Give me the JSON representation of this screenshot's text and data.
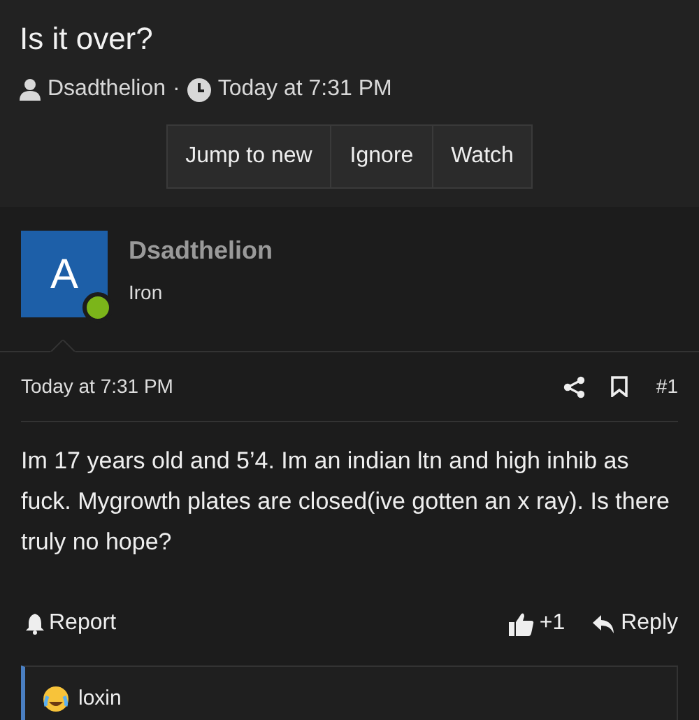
{
  "thread": {
    "title": "Is it over?",
    "author": "Dsadthelion",
    "separator": "·",
    "time": "Today at 7:31 PM"
  },
  "thread_buttons": [
    "Jump to new",
    "Ignore",
    "Watch"
  ],
  "post": {
    "avatar_letter": "A",
    "online": true,
    "username": "Dsadthelion",
    "user_title": "Iron",
    "time": "Today at 7:31 PM",
    "number": "#1",
    "body": "Im 17 years old and 5’4. Im an indian ltn and high inhib as fuck. Mygrowth plates are closed(ive gotten an x ray). Is there truly no hope?",
    "report": "Report",
    "like_count": "+1",
    "reply": "Reply"
  },
  "reactions": {
    "users": "loxin"
  }
}
